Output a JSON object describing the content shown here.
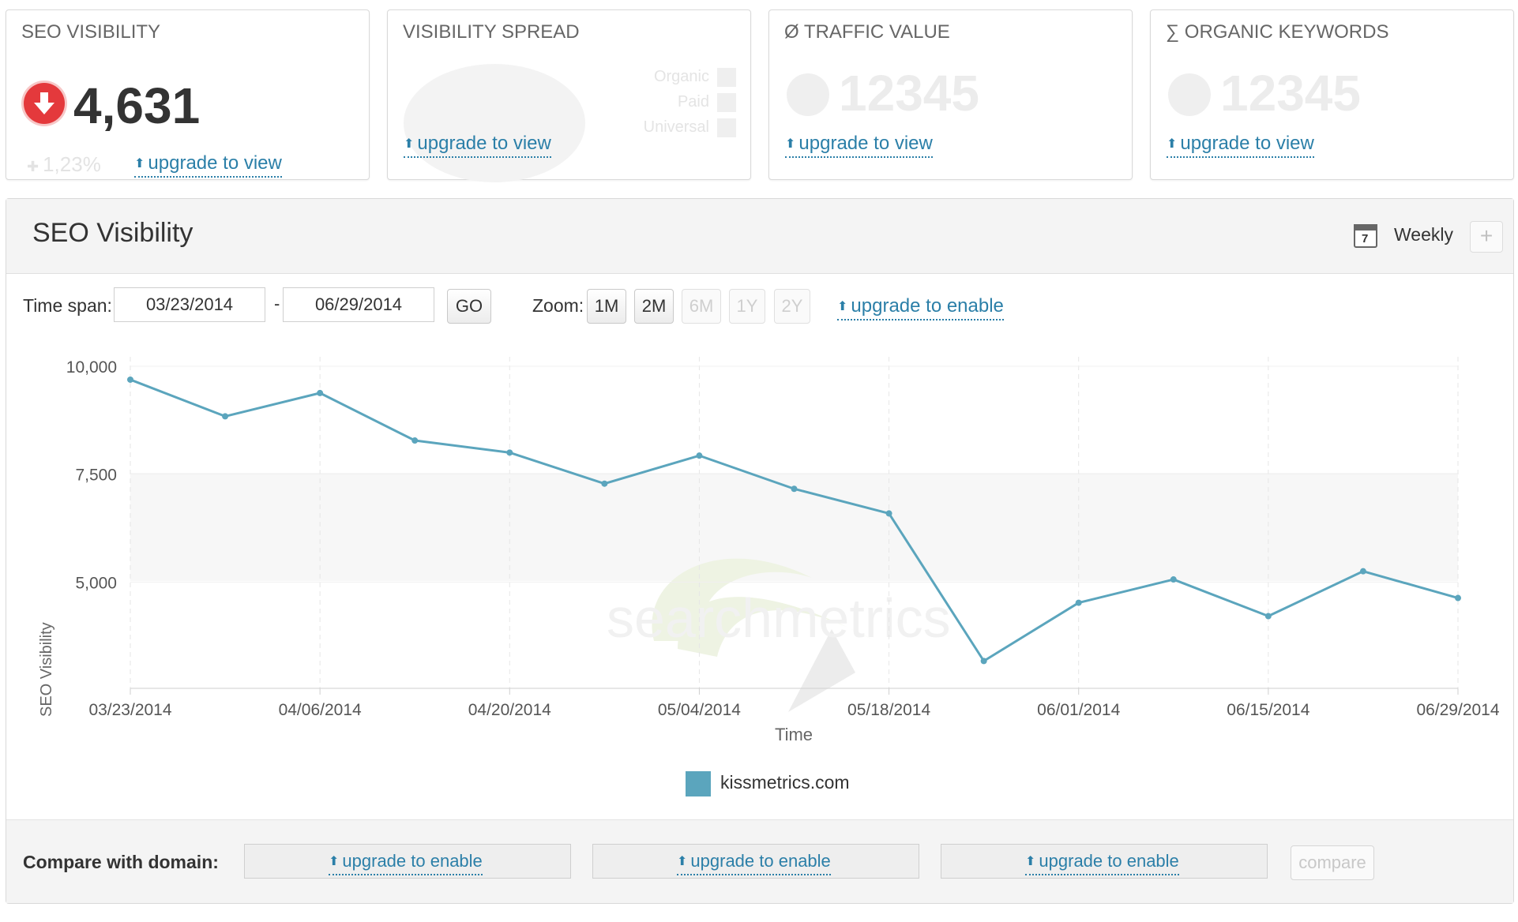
{
  "kpis": {
    "seo_visibility": {
      "title": "SEO VISIBILITY",
      "value": "4,631",
      "change": "1,23%",
      "upgrade": "upgrade to view"
    },
    "visibility_spread": {
      "title": "VISIBILITY SPREAD",
      "legend": [
        "Organic",
        "Paid",
        "Universal"
      ],
      "upgrade": "upgrade to view"
    },
    "traffic_value": {
      "title": "Ø TRAFFIC VALUE",
      "value": "12345",
      "upgrade": "upgrade to view"
    },
    "organic_keywords": {
      "title": "∑ ORGANIC KEYWORDS",
      "value": "12345",
      "upgrade": "upgrade to view"
    }
  },
  "panel": {
    "title": "SEO Visibility",
    "interval": "Weekly",
    "calendar_day": "7",
    "add_label": "+"
  },
  "controls": {
    "timespan_label": "Time span:",
    "date_from": "03/23/2014",
    "date_sep": "-",
    "date_to": "06/29/2014",
    "go_label": "GO",
    "zoom_label": "Zoom:",
    "zoom_options": [
      "1M",
      "2M",
      "6M",
      "1Y",
      "2Y"
    ],
    "upgrade": "upgrade to enable"
  },
  "chart_data": {
    "type": "line",
    "ylabel": "SEO Visibility",
    "xlabel": "Time",
    "watermark": "searchmetrics",
    "ylim": [
      2500,
      10000
    ],
    "yticks": [
      10000,
      7500,
      5000
    ],
    "ytick_labels": [
      "10,000",
      "7,500",
      "5,000"
    ],
    "xtick_labels": [
      "03/23/2014",
      "04/06/2014",
      "04/20/2014",
      "05/04/2014",
      "05/18/2014",
      "06/01/2014",
      "06/15/2014",
      "06/29/2014"
    ],
    "x": [
      "03/23/2014",
      "03/30/2014",
      "04/06/2014",
      "04/13/2014",
      "04/20/2014",
      "04/27/2014",
      "05/04/2014",
      "05/11/2014",
      "05/18/2014",
      "05/25/2014",
      "06/01/2014",
      "06/08/2014",
      "06/15/2014",
      "06/22/2014",
      "06/29/2014"
    ],
    "series": [
      {
        "name": "kissmetrics.com",
        "color": "#5ba5bd",
        "values": [
          9690,
          8840,
          9380,
          8280,
          8000,
          7280,
          7930,
          7160,
          6590,
          3170,
          4520,
          5060,
          4210,
          5250,
          4630
        ]
      }
    ]
  },
  "compare": {
    "label": "Compare with domain:",
    "slots": [
      "upgrade to enable",
      "upgrade to enable",
      "upgrade to enable"
    ],
    "button": "compare"
  }
}
